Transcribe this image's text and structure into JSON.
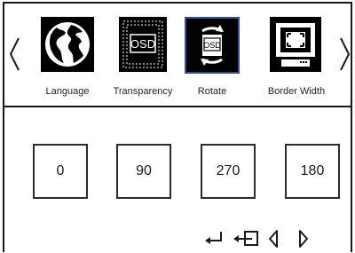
{
  "menu": {
    "items": [
      {
        "label": "Language",
        "icon": "globe-icon"
      },
      {
        "label": "Transparency",
        "icon": "osd-transparency-icon",
        "icon_text": "OSD"
      },
      {
        "label": "Rotate",
        "icon": "osd-rotate-icon",
        "icon_text": "OSD",
        "selected": true
      },
      {
        "label": "Border Width",
        "icon": "monitor-border-icon"
      }
    ],
    "nav": {
      "left": "chevron-left-icon",
      "right": "chevron-right-icon"
    },
    "selection_color": "#2f4f9f"
  },
  "rotate_options": [
    "0",
    "90",
    "270",
    "180"
  ],
  "footer": {
    "icons": [
      "enter-icon",
      "exit-icon",
      "chevron-left-icon",
      "chevron-right-icon"
    ]
  }
}
